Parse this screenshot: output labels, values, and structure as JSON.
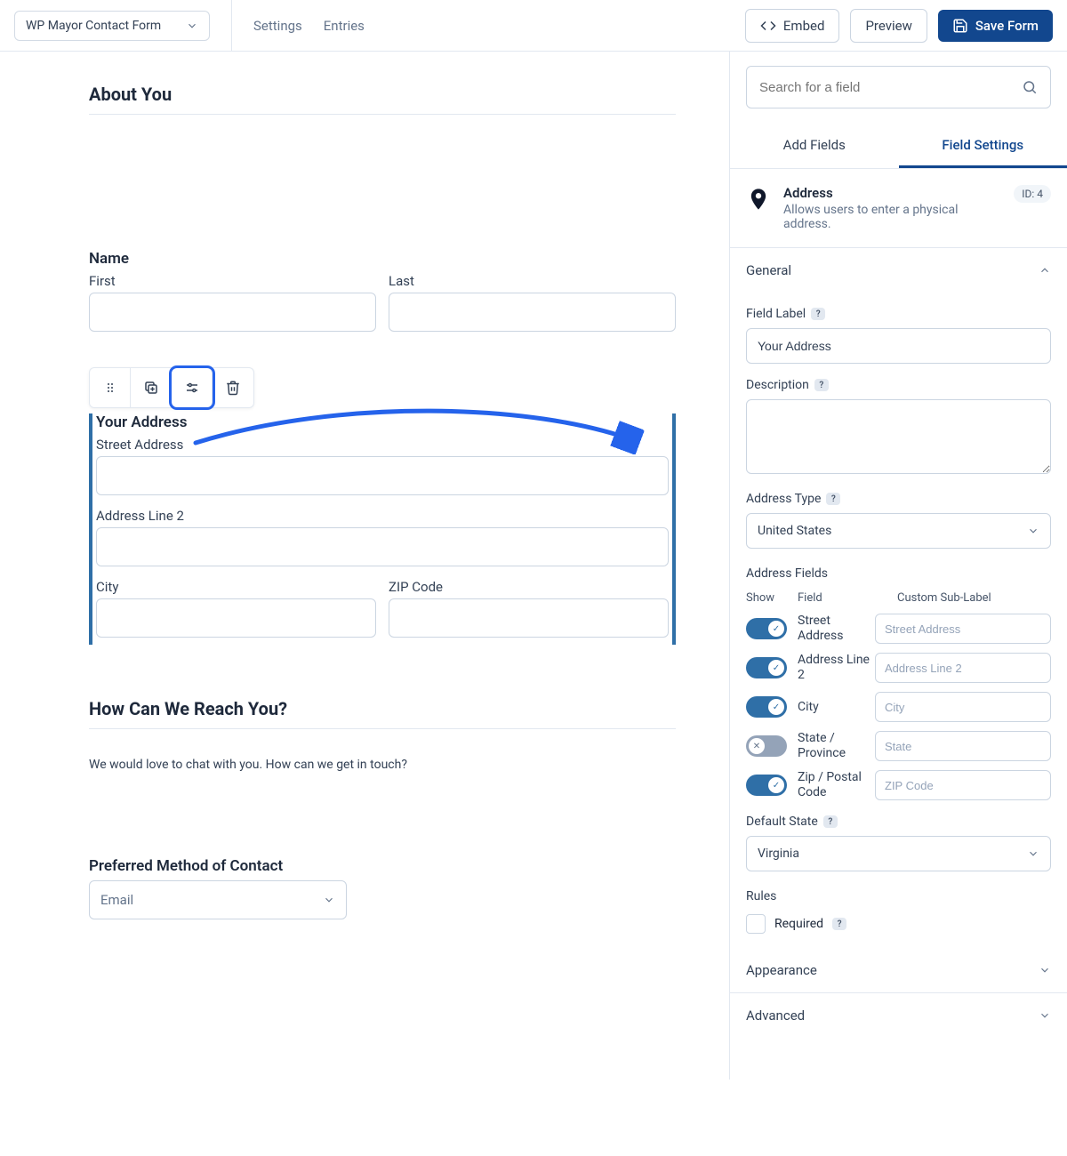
{
  "topbar": {
    "form_name": "WP Mayor Contact Form",
    "settings": "Settings",
    "entries": "Entries",
    "embed": "Embed",
    "preview": "Preview",
    "save": "Save Form"
  },
  "sections": {
    "about_you": "About You",
    "reach_you": "How Can We Reach You?",
    "reach_desc": "We would love to chat with you. How can we get in touch?",
    "preferred": "Preferred Method of Contact",
    "preferred_value": "Email"
  },
  "name_field": {
    "label": "Name",
    "first": "First",
    "last": "Last"
  },
  "address_field": {
    "label": "Your Address",
    "street": "Street Address",
    "line2": "Address Line 2",
    "city": "City",
    "zip": "ZIP Code"
  },
  "sidebar": {
    "search_ph": "Search for a field",
    "tab_add": "Add Fields",
    "tab_settings": "Field Settings",
    "info_title": "Address",
    "info_desc": "Allows users to enter a physical address.",
    "id_badge": "ID: 4",
    "general": "General",
    "field_label": "Field Label",
    "field_label_value": "Your Address",
    "description": "Description",
    "address_type": "Address Type",
    "address_type_value": "United States",
    "address_fields": "Address Fields",
    "col_show": "Show",
    "col_field": "Field",
    "col_custom": "Custom Sub-Label",
    "rows": [
      {
        "on": true,
        "field": "Street Address",
        "ph": "Street Address"
      },
      {
        "on": true,
        "field": "Address Line 2",
        "ph": "Address Line 2"
      },
      {
        "on": true,
        "field": "City",
        "ph": "City"
      },
      {
        "on": false,
        "field": "State / Province",
        "ph": "State"
      },
      {
        "on": true,
        "field": "Zip / Postal Code",
        "ph": "ZIP Code"
      }
    ],
    "default_state": "Default State",
    "default_state_value": "Virginia",
    "rules": "Rules",
    "required": "Required",
    "appearance": "Appearance",
    "advanced": "Advanced"
  }
}
